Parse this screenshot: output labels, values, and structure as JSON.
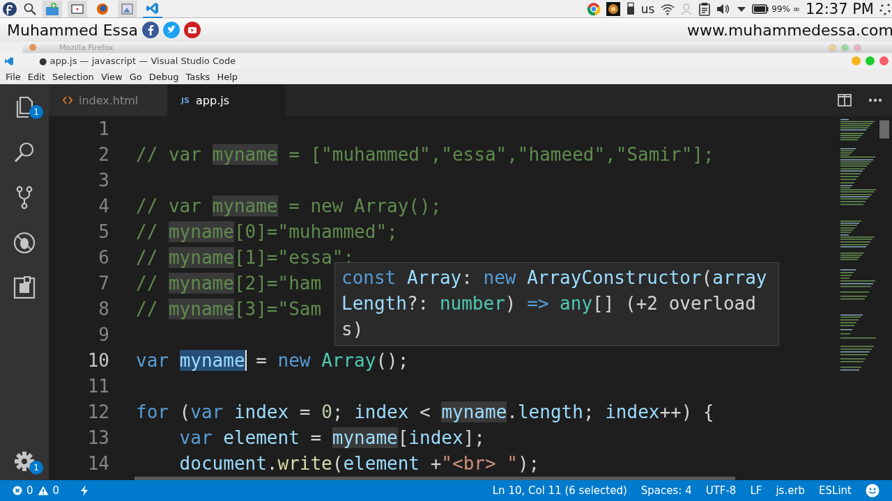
{
  "desktop_panel": {
    "keyboard_layout": "us",
    "battery": "99%",
    "battery_extra": "∞",
    "clock": "12:37 PM"
  },
  "banner": {
    "name": "Muhammed Essa",
    "website": "www.muhammedessa.com"
  },
  "background_window": {
    "title": "Mozilla Firefox"
  },
  "window": {
    "title": "● app.js — javascript — Visual Studio Code"
  },
  "menu": [
    "File",
    "Edit",
    "Selection",
    "View",
    "Go",
    "Debug",
    "Tasks",
    "Help"
  ],
  "activity_bar": {
    "explorer_badge": "1",
    "settings_badge": "1"
  },
  "tabs": [
    {
      "label": "index.html",
      "kind": "html",
      "selected": false,
      "modified": false
    },
    {
      "label": "app.js",
      "kind": "js",
      "icon_text": "JS",
      "selected": true,
      "modified": true
    }
  ],
  "editor": {
    "lines": [
      {
        "number": "1",
        "current": false
      },
      {
        "number": "2",
        "current": false,
        "tokens": [
          {
            "text": "// var ",
            "kind": "comment"
          },
          {
            "text": "myname",
            "kind": "comment",
            "highlighted": true
          },
          {
            "text": " = [\"muhammed\",\"essa\",\"hameed\",\"Samir\"];",
            "kind": "comment"
          }
        ]
      },
      {
        "number": "3",
        "current": false
      },
      {
        "number": "4",
        "current": false,
        "tokens": [
          {
            "text": "// var ",
            "kind": "comment"
          },
          {
            "text": "myname",
            "kind": "comment",
            "highlighted": true
          },
          {
            "text": " = new Array();",
            "kind": "comment"
          }
        ]
      },
      {
        "number": "5",
        "current": false,
        "tokens": [
          {
            "text": "// ",
            "kind": "comment"
          },
          {
            "text": "myname",
            "kind": "comment",
            "highlighted": true
          },
          {
            "text": "[0]=\"muhammed\";",
            "kind": "comment"
          }
        ]
      },
      {
        "number": "6",
        "current": false,
        "tokens": [
          {
            "text": "// ",
            "kind": "comment"
          },
          {
            "text": "myname",
            "kind": "comment",
            "highlighted": true
          },
          {
            "text": "[1]=\"essa\";",
            "kind": "comment"
          }
        ]
      },
      {
        "number": "7",
        "current": false,
        "tokens": [
          {
            "text": "// ",
            "kind": "comment"
          },
          {
            "text": "myname",
            "kind": "comment",
            "highlighted": true
          },
          {
            "text": "[2]=\"ham",
            "kind": "comment"
          }
        ]
      },
      {
        "number": "8",
        "current": false,
        "tokens": [
          {
            "text": "// ",
            "kind": "comment"
          },
          {
            "text": "myname",
            "kind": "comment",
            "highlighted": true
          },
          {
            "text": "[3]=\"Sam",
            "kind": "comment"
          }
        ]
      },
      {
        "number": "9",
        "current": false
      },
      {
        "number": "10",
        "current": true,
        "tokens": [
          {
            "text": "var ",
            "kind": "keyword"
          },
          {
            "text": "myname",
            "kind": "variable",
            "selected": true,
            "cursor": true
          },
          {
            "text": " = ",
            "kind": "plain"
          },
          {
            "text": "new ",
            "kind": "keyword"
          },
          {
            "text": "Array",
            "kind": "class"
          },
          {
            "text": "();",
            "kind": "plain"
          }
        ]
      },
      {
        "number": "11",
        "current": false
      },
      {
        "number": "12",
        "current": false,
        "tokens": [
          {
            "text": "for",
            "kind": "keyword"
          },
          {
            "text": " (",
            "kind": "plain"
          },
          {
            "text": "var ",
            "kind": "keyword"
          },
          {
            "text": "index",
            "kind": "variable"
          },
          {
            "text": " = ",
            "kind": "plain"
          },
          {
            "text": "0",
            "kind": "number"
          },
          {
            "text": "; ",
            "kind": "plain"
          },
          {
            "text": "index",
            "kind": "variable"
          },
          {
            "text": " < ",
            "kind": "plain"
          },
          {
            "text": "myname",
            "kind": "variable",
            "highlighted": true
          },
          {
            "text": ".",
            "kind": "plain"
          },
          {
            "text": "length",
            "kind": "variable"
          },
          {
            "text": "; ",
            "kind": "plain"
          },
          {
            "text": "index",
            "kind": "variable"
          },
          {
            "text": "++) {",
            "kind": "plain"
          }
        ]
      },
      {
        "number": "13",
        "current": false,
        "tokens": [
          {
            "text": "    var ",
            "kind": "keyword"
          },
          {
            "text": "element",
            "kind": "variable"
          },
          {
            "text": " = ",
            "kind": "plain"
          },
          {
            "text": "myname",
            "kind": "variable",
            "highlighted": true
          },
          {
            "text": "[",
            "kind": "plain"
          },
          {
            "text": "index",
            "kind": "variable"
          },
          {
            "text": "];",
            "kind": "plain"
          }
        ]
      },
      {
        "number": "14",
        "current": false,
        "tokens": [
          {
            "text": "    document",
            "kind": "variable"
          },
          {
            "text": ".",
            "kind": "plain"
          },
          {
            "text": "write",
            "kind": "function"
          },
          {
            "text": "(",
            "kind": "plain"
          },
          {
            "text": "element",
            "kind": "variable"
          },
          {
            "text": " +",
            "kind": "plain"
          },
          {
            "text": "\"<br> \"",
            "kind": "string"
          },
          {
            "text": ");",
            "kind": "plain"
          }
        ]
      }
    ]
  },
  "hover": {
    "tokens": [
      {
        "text": "const ",
        "kind": "keyword"
      },
      {
        "text": "Array",
        "kind": "variable"
      },
      {
        "text": ": ",
        "kind": "plain"
      },
      {
        "text": "new ",
        "kind": "keyword"
      },
      {
        "text": "ArrayConstructor",
        "kind": "variable"
      },
      {
        "text": "(",
        "kind": "plain"
      },
      {
        "text": "arrayLength",
        "kind": "variable"
      },
      {
        "text": "?: ",
        "kind": "plain"
      },
      {
        "text": "number",
        "kind": "class"
      },
      {
        "text": ") ",
        "kind": "plain"
      },
      {
        "text": "=>",
        "kind": "keyword"
      },
      {
        "text": " any",
        "kind": "class"
      },
      {
        "text": "[] (+2 overloads)",
        "kind": "plain"
      }
    ]
  },
  "status_bar": {
    "errors": "0",
    "warnings": "0",
    "items": [
      "Ln 10, Col 11 (6 selected)",
      "Spaces: 4",
      "UTF-8",
      "LF",
      "js.erb",
      "ESLint"
    ]
  }
}
